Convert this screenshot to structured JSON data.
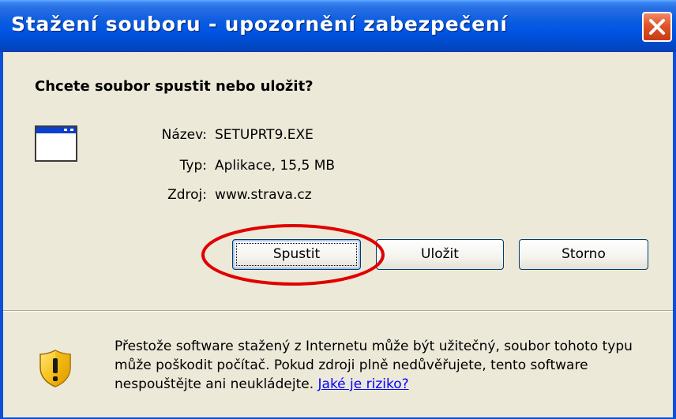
{
  "window": {
    "title": "Stažení souboru - upozornění zabezpečení",
    "close_icon": "close-icon",
    "accent_color": "#0054e3",
    "close_color": "#e0532a"
  },
  "dialog": {
    "question": "Chcete soubor spustit nebo uložit?",
    "file_icon": "application-window-icon",
    "fields": {
      "name_label": "Název:",
      "name_value": "SETUPRT9.EXE",
      "type_label": "Typ:",
      "type_value": "Aplikace, 15,5 MB",
      "source_label": "Zdroj:",
      "source_value": "www.strava.cz"
    },
    "buttons": {
      "run_label": "Spustit",
      "save_label": "Uložit",
      "cancel_label": "Storno"
    },
    "annotation_color": "#e00000"
  },
  "warning": {
    "icon": "security-shield-warning-icon",
    "text": "Přestože software stažený z Internetu může být užitečný, soubor tohoto typu může poškodit počítač. Pokud zdroji plně nedůvěřujete, tento software nespouštějte ani neukládejte.",
    "link_label": "Jaké je riziko?",
    "link_color": "#0000ff"
  }
}
